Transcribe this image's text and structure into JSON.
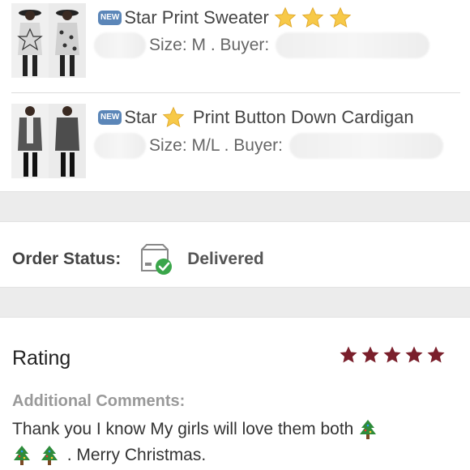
{
  "items": [
    {
      "badge": "NEW",
      "title_parts": [
        "Star Print Sweater"
      ],
      "size": "Size: M . Buyer:"
    },
    {
      "badge": "NEW",
      "title_parts": [
        "Star",
        "Print Button Down Cardigan"
      ],
      "size": "Size: M/L . Buyer:"
    }
  ],
  "order_status": {
    "label": "Order Status:",
    "value": "Delivered",
    "icon": "box-check-icon"
  },
  "rating": {
    "title": "Rating",
    "stars": 5,
    "max_stars": 5,
    "star_color": "#7a1f2b"
  },
  "comments": {
    "label": "Additional Comments:",
    "text_line1": "Thank you I know My girls will love them both",
    "text_line2": ". Merry Christmas."
  },
  "colors": {
    "badge": "#5b86b8",
    "check": "#3aa64a",
    "band": "#ececec"
  }
}
